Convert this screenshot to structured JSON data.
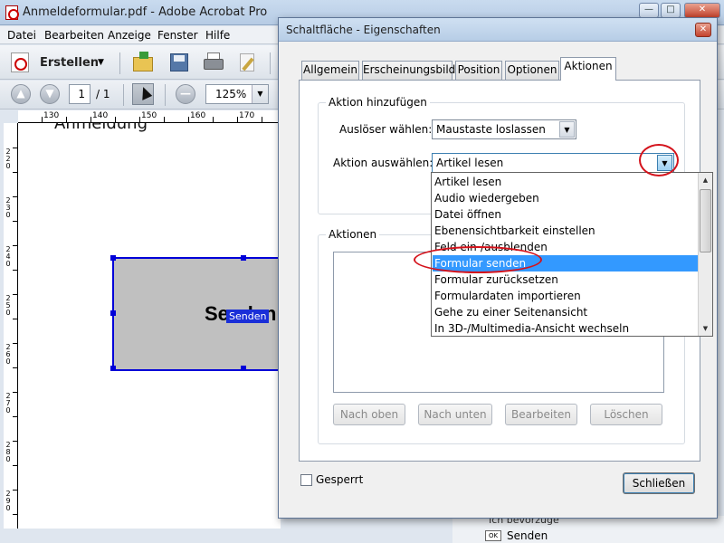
{
  "window": {
    "title": "Anmeldeformular.pdf - Adobe Acrobat Pro",
    "min_glyph": "—",
    "max_glyph": "□",
    "close_glyph": "✕"
  },
  "menu": [
    "Datei",
    "Bearbeiten",
    "Anzeige",
    "Fenster",
    "Hilfe"
  ],
  "toolbar": {
    "create_label": "Erstellen",
    "create_arrow": "▼"
  },
  "nav": {
    "page_current": "1",
    "page_total": "/ 1",
    "zoom": "125%",
    "zoom_arrow": "▼",
    "prev_glyph": "▲",
    "next_glyph": "▼",
    "zoom_out_glyph": "—"
  },
  "ruler": {
    "h_ticks": [
      "130",
      "140",
      "150",
      "160",
      "170"
    ],
    "v_ticks": [
      "2\n2\n0",
      "2\n3\n0",
      "2\n4\n0",
      "2\n5\n0",
      "2\n6\n0",
      "2\n7\n0",
      "2\n8\n0",
      "2\n9\n0"
    ]
  },
  "document": {
    "heading": "Anmeldung",
    "button_text": "Senden",
    "field_name": "Senden"
  },
  "bottom_panel": {
    "row1": "Ich bevorzuge",
    "ok_icon": "OK",
    "send_label": "Senden"
  },
  "dialog": {
    "title": "Schaltfläche - Eigenschaften",
    "close_glyph": "✕",
    "tabs": [
      "Allgemein",
      "Erscheinungsbild",
      "Position",
      "Optionen",
      "Aktionen"
    ],
    "active_tab": "Aktionen",
    "add_action_group": "Aktion hinzufügen",
    "trigger_label": "Auslöser wählen:",
    "trigger_value": "Maustaste loslassen",
    "action_label": "Aktion auswählen:",
    "action_value": "Artikel lesen",
    "combo_arrow": "▼",
    "actions_group": "Aktionen",
    "buttons": {
      "up": "Nach oben",
      "down": "Nach unten",
      "edit": "Bearbeiten",
      "delete": "Löschen",
      "close": "Schließen"
    },
    "locked_label": "Gesperrt"
  },
  "dropdown": {
    "options": [
      "Artikel lesen",
      "Audio wiedergeben",
      "Datei öffnen",
      "Ebenensichtbarkeit einstellen",
      "Feld ein-/ausblenden",
      "Formular senden",
      "Formular zurücksetzen",
      "Formulardaten importieren",
      "Gehe zu einer Seitenansicht",
      "In 3D-/Multimedia-Ansicht wechseln"
    ],
    "selected_index": 5,
    "scroll_up": "▲",
    "scroll_down": "▼"
  },
  "colors": {
    "selection": "#3399ff",
    "highlight_ellipse": "#d4121b",
    "field_border": "#0000d8"
  }
}
